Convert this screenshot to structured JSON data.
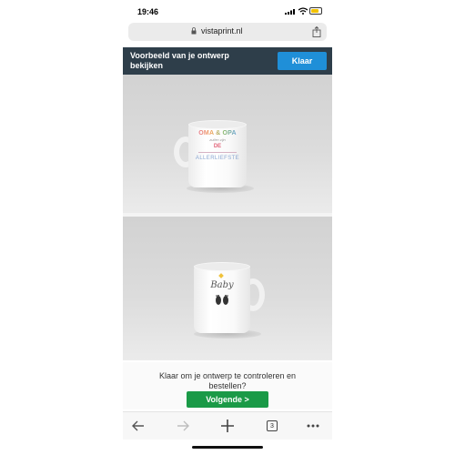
{
  "status": {
    "time": "19:46",
    "battery_level": 0.75
  },
  "browser": {
    "url": "vistaprint.nl",
    "tab_count": "3"
  },
  "preview": {
    "title": "Voorbeeld van je ontwerp bekijken",
    "done_label": "Klaar"
  },
  "mug1": {
    "line1": "OMA & OPA",
    "line2": "zullen zijn",
    "line3": "DE",
    "line4": "ALLERLIEFSTE"
  },
  "mug2": {
    "script": "Baby"
  },
  "checkout": {
    "question": "Klaar om je ontwerp te controleren en bestellen?",
    "next_label": "Volgende >"
  },
  "colors": {
    "header_bg": "#2e3e4a",
    "accent_blue": "#1f8fd8",
    "accent_green": "#1a9a47"
  }
}
